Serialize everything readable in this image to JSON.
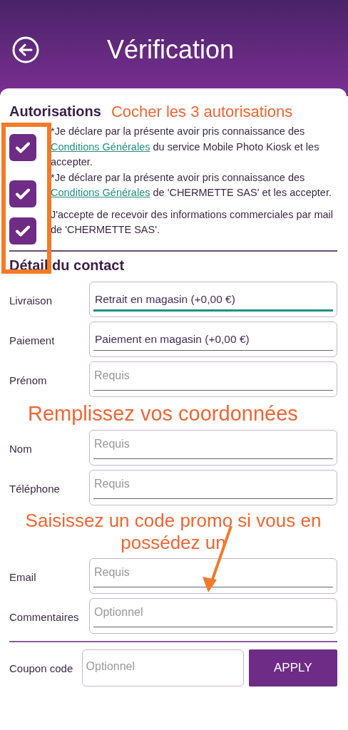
{
  "header": {
    "title": "Vérification"
  },
  "authorizations": {
    "heading": "Autorisations",
    "items": [
      {
        "checked": true,
        "parts": [
          {
            "kind": "text",
            "text": "*Je déclare par la présente avoir pris connaissance des "
          },
          {
            "kind": "link",
            "text": "Conditions Générales"
          },
          {
            "kind": "text",
            "text": " du service Mobile Photo Kiosk et les accepter."
          }
        ]
      },
      {
        "checked": true,
        "parts": [
          {
            "kind": "text",
            "text": "*Je déclare par la présente avoir pris connaissance des "
          },
          {
            "kind": "link",
            "text": "Conditions Générales"
          },
          {
            "kind": "text",
            "text": " de 'CHERMETTE SAS' et les accepter."
          }
        ]
      },
      {
        "checked": true,
        "parts": [
          {
            "kind": "text",
            "text": "J'accepte de recevoir des informations commerciales par mail de 'CHERMETTE SAS'."
          }
        ]
      }
    ]
  },
  "contact": {
    "heading": "Détail du contact",
    "fields": [
      {
        "label": "Livraison",
        "kind": "select",
        "value": "Retrait en magasin (+0,00 €)",
        "focused": true
      },
      {
        "label": "Paiement",
        "kind": "select",
        "value": "Paiement en magasin (+0,00 €)",
        "focused": false
      },
      {
        "label": "Prénom",
        "kind": "input",
        "placeholder": "Requis",
        "focused": false
      },
      {
        "label": "Nom",
        "kind": "input",
        "placeholder": "Requis",
        "focused": false
      },
      {
        "label": "Téléphone",
        "kind": "input",
        "placeholder": "Requis",
        "focused": false
      },
      {
        "label": "Email",
        "kind": "input",
        "placeholder": "Requis",
        "focused": false
      },
      {
        "label": "Commentaires",
        "kind": "input",
        "placeholder": "Optionnel",
        "focused": false
      }
    ]
  },
  "coupon": {
    "label": "Coupon code",
    "placeholder": "Optionnel",
    "button": "APPLY"
  },
  "annotations": [
    "Cocher les 3 autorisations",
    "Remplissez vos coordonnées",
    "Saisissez un code promo si vous en possédez un"
  ]
}
